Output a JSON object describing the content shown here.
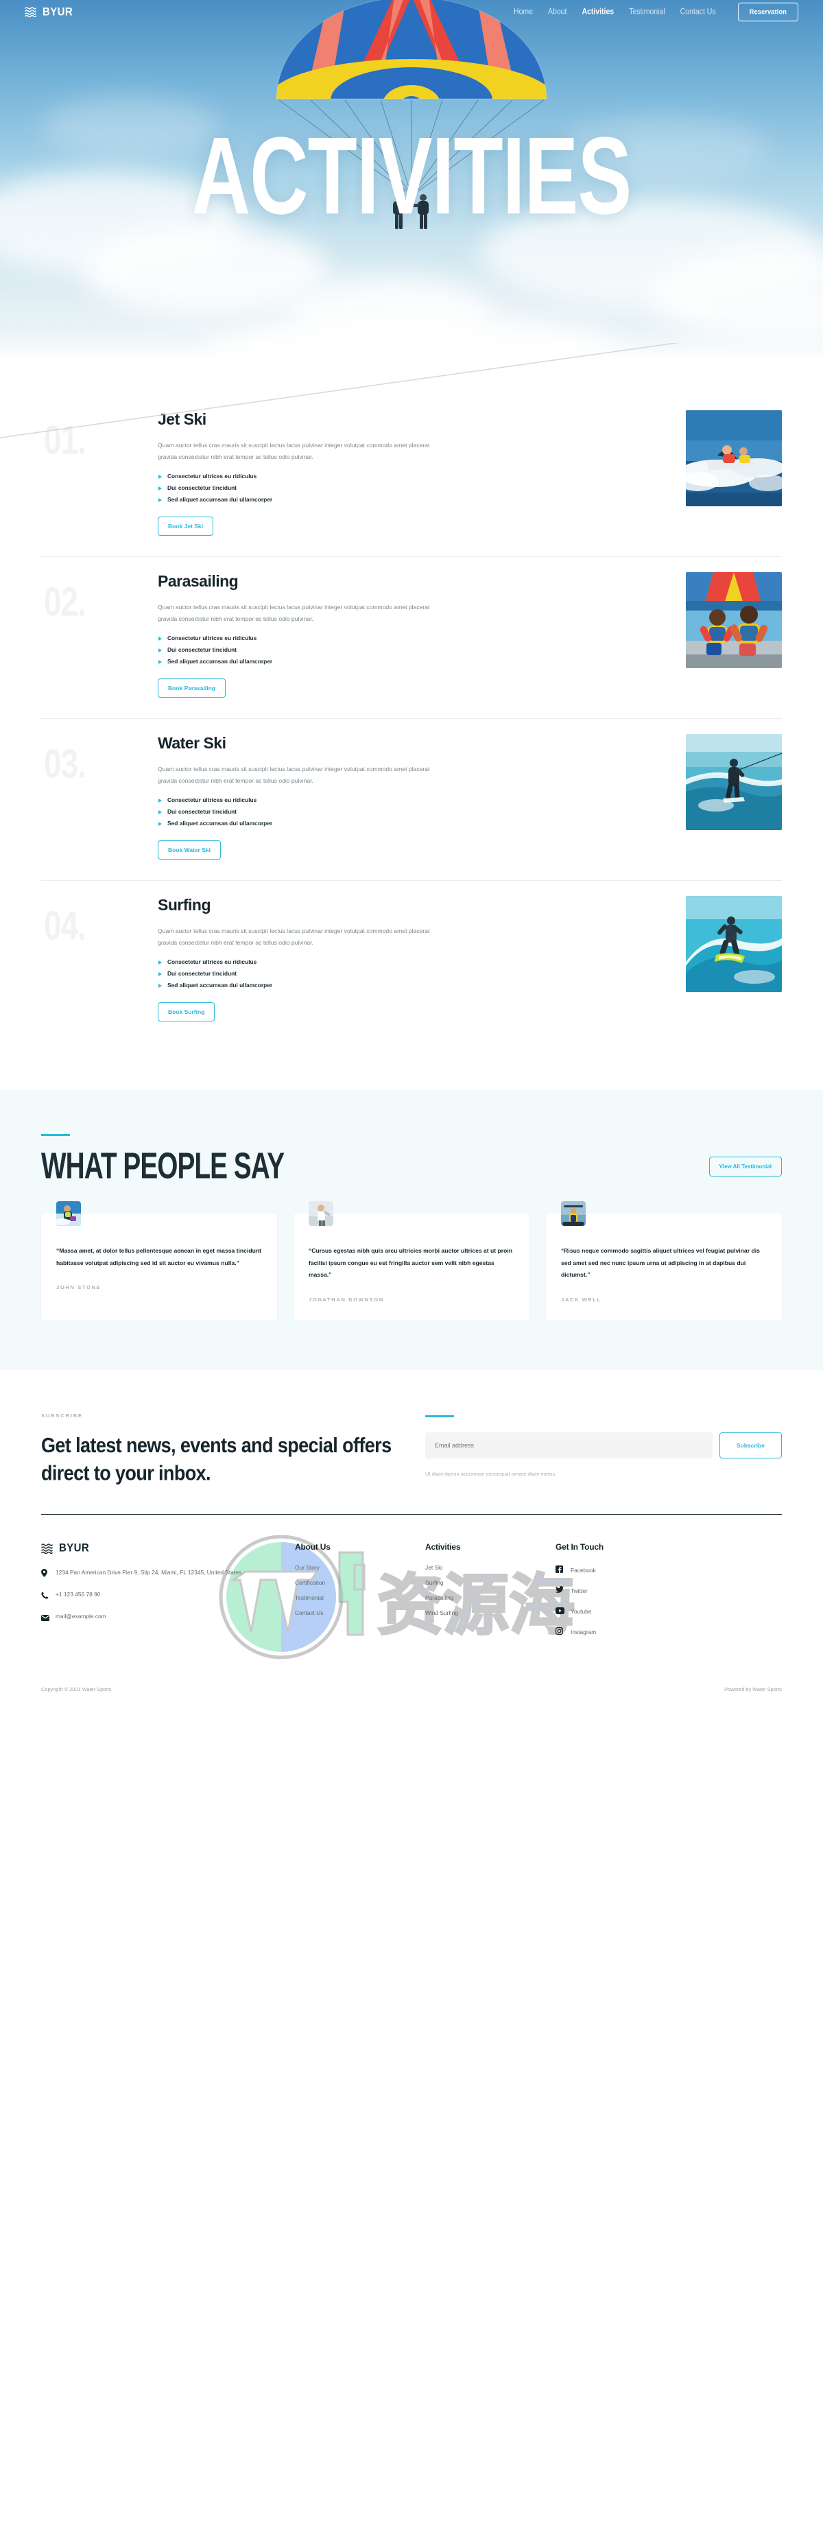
{
  "nav": {
    "brand": "BYUR",
    "logo_icon": "wave-lines-icon",
    "menu_icon": "hamburger-icon",
    "links": [
      {
        "label": "Home",
        "active": false
      },
      {
        "label": "About",
        "active": false
      },
      {
        "label": "Activities",
        "active": true
      },
      {
        "label": "Testimonial",
        "active": false
      },
      {
        "label": "Contact Us",
        "active": false
      }
    ],
    "cta": "Reservation"
  },
  "hero": {
    "title": "ACTIVITIES",
    "image_alt": "parasailing-parachute-photo"
  },
  "activities": {
    "items": [
      {
        "number": "01.",
        "title": "Jet Ski",
        "description": "Quam auctor tellus cras mauris sit suscipit lectus lacus pulvinar integer volutpat commodo amet placerat gravida consectetur nibh erat tempor ac tellus odio pulvinar.",
        "features": [
          "Consectetur ultrices eu ridiculus",
          "Dui consectetur tincidunt",
          "Sed aliquet accumsan dui ullamcorper"
        ],
        "button": "Book Jet Ski",
        "photo": "jet-ski-photo"
      },
      {
        "number": "02.",
        "title": "Parasailing",
        "description": "Quam auctor tellus cras mauris sit suscipit lectus lacus pulvinar integer volutpat commodo amet placerat gravida consectetur nibh erat tempor ac tellus odio pulvinar.",
        "features": [
          "Consectetur ultrices eu ridiculus",
          "Dui consectetur tincidunt",
          "Sed aliquet accumsan dui ullamcorper"
        ],
        "button": "Book Parasailing",
        "photo": "parasailing-photo"
      },
      {
        "number": "03.",
        "title": "Water Ski",
        "description": "Quam auctor tellus cras mauris sit suscipit lectus lacus pulvinar integer volutpat commodo amet placerat gravida consectetur nibh erat tempor ac tellus odio pulvinar.",
        "features": [
          "Consectetur ultrices eu ridiculus",
          "Dui consectetur tincidunt",
          "Sed aliquet accumsan dui ullamcorper"
        ],
        "button": "Book Water Ski",
        "photo": "water-ski-photo"
      },
      {
        "number": "04.",
        "title": "Surfing",
        "description": "Quam auctor tellus cras mauris sit suscipit lectus lacus pulvinar integer volutpat commodo amet placerat gravida consectetur nibh erat tempor ac tellus odio pulvinar.",
        "features": [
          "Consectetur ultrices eu ridiculus",
          "Dui consectetur tincidunt",
          "Sed aliquet accumsan dui ullamcorper"
        ],
        "button": "Book Surfing",
        "photo": "surfing-photo"
      }
    ]
  },
  "testimonials": {
    "title": "WHAT PEOPLE SAY",
    "view_all": "View All Testimonial",
    "cards": [
      {
        "quote": "“Massa amet, at dolor tellus pellentesque aenean in eget massa tincidunt habitasse volutpat adipiscing sed id sit auctor eu vivamus nulla.”",
        "name": "JOHN STONE",
        "avatar": "jet-ski-rider-avatar"
      },
      {
        "quote": "“Cursus egestas nibh quis arcu ultricies morbi auctor ultrices at ut proin facilisi ipsum congue eu est fringilla auctor sem velit nibh egestas massa.”",
        "name": "JONATHAN DOWNSON",
        "avatar": "surfer-avatar"
      },
      {
        "quote": "“Risus neque commodo sagittis aliquet ultrices vel feugiat pulvinar dis sed amet sed nec nunc ipsum urna ut adipiscing in at dapibus dui dictumst.”",
        "name": "JACK WELL",
        "avatar": "kayaker-avatar"
      }
    ]
  },
  "subscribe": {
    "kicker": "SUBSCRIBE",
    "heading": "Get latest news, events and special offers direct to your inbox.",
    "input_placeholder": "Email address",
    "input_value": "",
    "button": "Subscribe",
    "note": "Ut diam lacinia accumsan consequat ornare diam metus."
  },
  "footer": {
    "brand": "BYUR",
    "contact": [
      {
        "icon": "location-pin-icon",
        "text": "1234 Pan American Drive Pier 9, Slip 24, Miami, FL 12345, United States."
      },
      {
        "icon": "phone-icon",
        "text": "+1 123 456 78 90"
      },
      {
        "icon": "mail-icon",
        "text": "mail@example.com"
      }
    ],
    "columns": [
      {
        "title": "About Us",
        "links": [
          "Our Story",
          "Certification",
          "Testimonial",
          "Contact Us"
        ]
      },
      {
        "title": "Activities",
        "links": [
          "Jet Ski",
          "Surfing",
          "Parasailing",
          "Wind Surfing"
        ]
      }
    ],
    "social_title": "Get In Touch",
    "social": [
      {
        "icon": "facebook-icon",
        "label": "Facebook"
      },
      {
        "icon": "twitter-icon",
        "label": "Twitter"
      },
      {
        "icon": "youtube-icon",
        "label": "Youtube"
      },
      {
        "icon": "instagram-icon",
        "label": "Instagram"
      }
    ],
    "copyright": "Copyright © 2021 Water Sports",
    "powered": "Powered by Water Sports"
  },
  "colors": {
    "accent": "#2bb8dd",
    "dark": "#16252b",
    "muted": "#7b868c",
    "testimonial_bg": "#f2fafb"
  },
  "watermark": {
    "text": "WP资源海"
  }
}
